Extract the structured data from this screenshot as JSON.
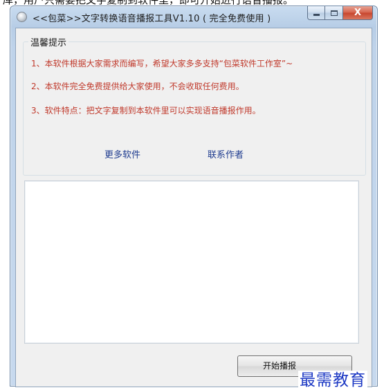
{
  "caption_cropped": "库，用户只需要把文字复制到软件里，即可开始进行语音播报。",
  "window": {
    "title": "<<包菜>>文字转换语音播报工具V1.10 ( 完全免费使用 )",
    "close_symbol": "X"
  },
  "notice": {
    "group_title": "温馨提示",
    "tips": [
      "1、本软件根据大家需求而编写，希望大家多多支持“包菜软件工作室”~",
      "2、本软件完全免费提供给大家使用，不会收取任何费用。",
      "3、软件特点：把文字复制到本软件里可以实现语音播报作用。"
    ],
    "links": {
      "more_software": "更多软件",
      "contact_author": "联系作者"
    }
  },
  "input": {
    "text_value": ""
  },
  "actions": {
    "start_button": "开始播报"
  },
  "watermark": "最需教育",
  "colors": {
    "tip_text": "#c0392b",
    "link_text": "#1e3b8f",
    "watermark": "#1d39c4"
  },
  "icons": {
    "app": "app-icon",
    "minimize": "minimize-icon",
    "maximize": "maximize-icon",
    "close": "close-icon"
  }
}
